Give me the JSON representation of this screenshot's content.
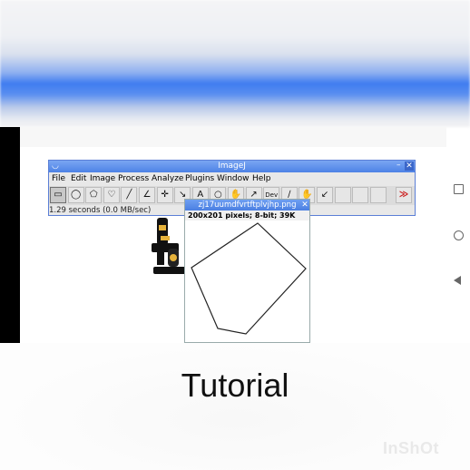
{
  "imagej": {
    "title": "ImageJ",
    "minimize": "–",
    "close": "✕",
    "menus": [
      "File",
      "Edit",
      "Image",
      "Process",
      "Analyze",
      "Plugins",
      "Window",
      "Help"
    ],
    "tools": [
      {
        "name": "rectangle-tool",
        "glyph": "▭",
        "selected": true
      },
      {
        "name": "oval-tool",
        "glyph": "◯"
      },
      {
        "name": "polygon-tool",
        "glyph": "⬠"
      },
      {
        "name": "freehand-tool",
        "glyph": "♡"
      },
      {
        "name": "line-tool",
        "glyph": "╱"
      },
      {
        "name": "angle-tool",
        "glyph": "∠"
      },
      {
        "name": "point-tool",
        "glyph": "✛"
      },
      {
        "name": "wand-tool",
        "glyph": "↘"
      },
      {
        "name": "text-tool",
        "glyph": "A"
      },
      {
        "name": "magnifier-tool",
        "glyph": "○"
      },
      {
        "name": "scrolling-tool",
        "glyph": "✋"
      },
      {
        "name": "color-picker-tool",
        "glyph": "↗"
      },
      {
        "name": "developer-menu-tool",
        "glyph": "Dev"
      },
      {
        "name": "brush-tool",
        "glyph": "∕"
      },
      {
        "name": "hand-tool",
        "glyph": "✋"
      },
      {
        "name": "dropper-tool",
        "glyph": "↙"
      },
      {
        "name": "blank-tool-1",
        "glyph": ""
      },
      {
        "name": "blank-tool-2",
        "glyph": ""
      },
      {
        "name": "blank-tool-3",
        "glyph": ""
      },
      {
        "name": "more-tools",
        "glyph": "≫"
      }
    ],
    "status": "1.29 seconds (0.0 MB/sec)"
  },
  "image_window": {
    "title": "zj17uumdfvrtftplvjhp.png",
    "close": "✕",
    "info": "200x201 pixels; 8-bit; 39K"
  },
  "caption": "Tutorial",
  "watermark": "InShOt",
  "colors": {
    "titlebar": "#4d82e6",
    "banner_blue": "#3f7cf0",
    "more_tools": "#cc2222"
  }
}
